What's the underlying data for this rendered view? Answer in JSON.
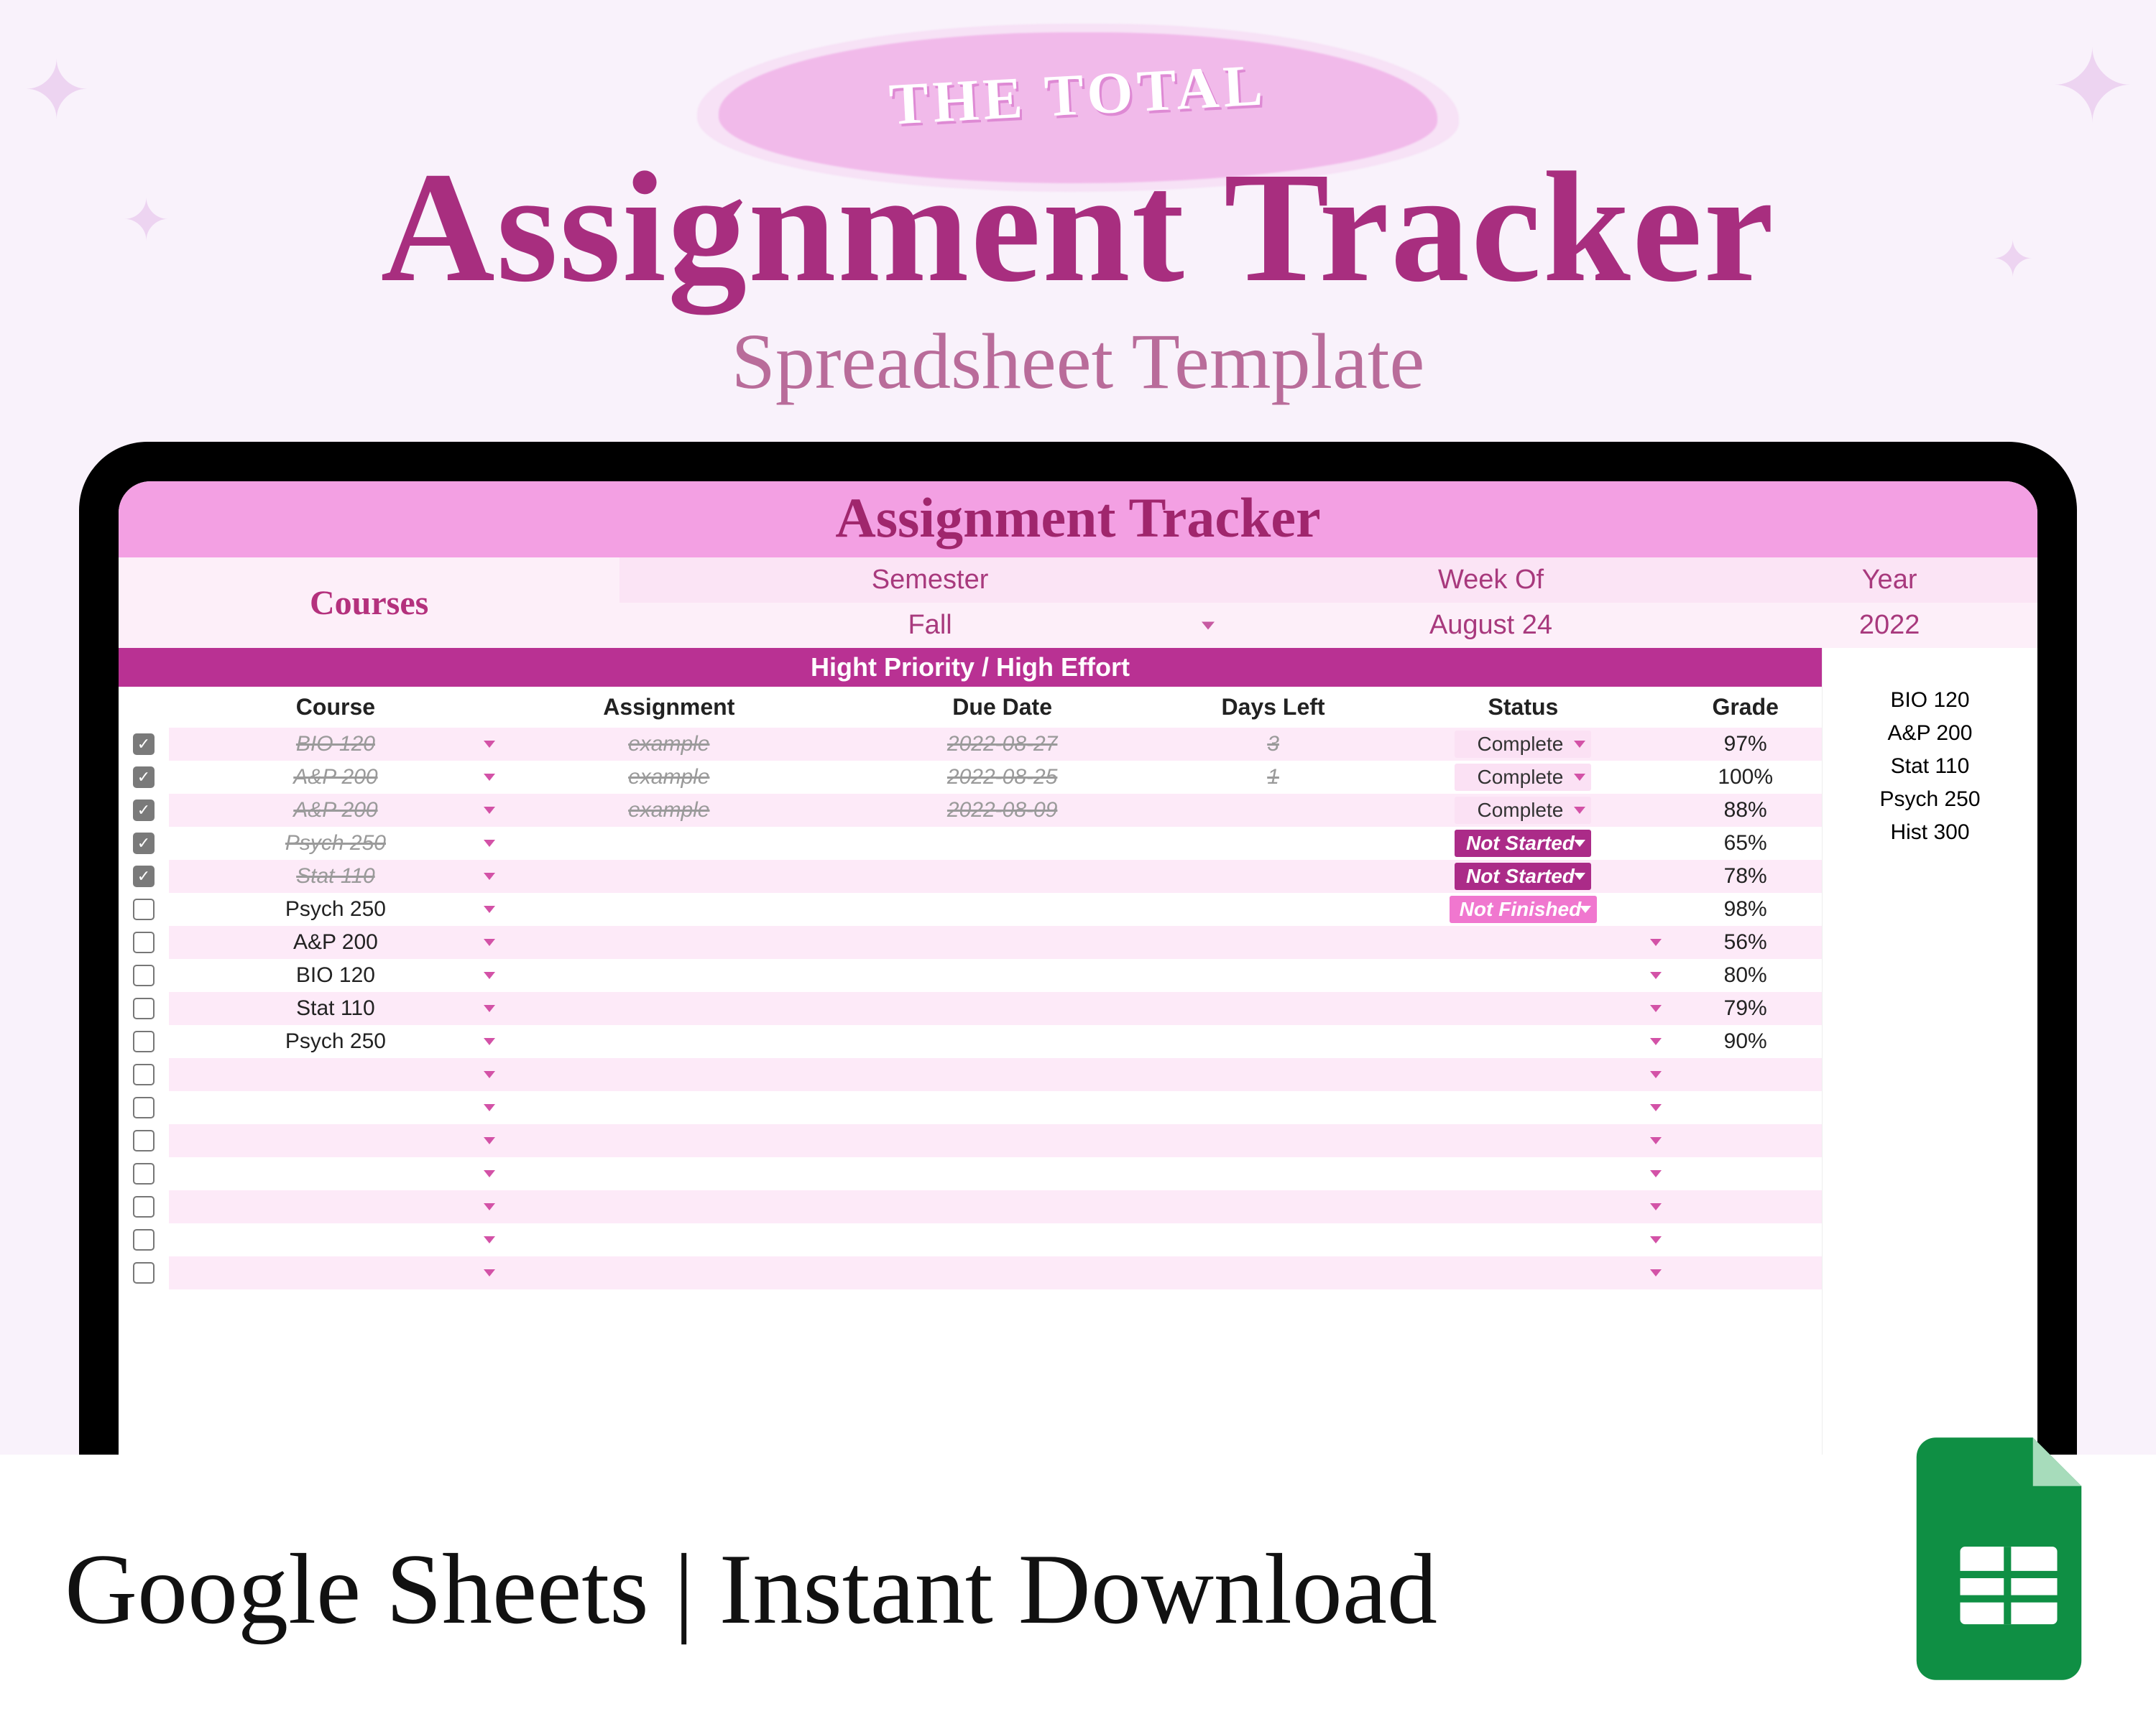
{
  "hero": {
    "pretitle": "THE TOTAL",
    "title": "Assignment Tracker",
    "subtitle": "Spreadsheet Template"
  },
  "spreadsheet": {
    "title": "Assignment Tracker",
    "meta": {
      "semester_label": "Semester",
      "week_label": "Week Of",
      "year_label": "Year",
      "courses_label": "Courses",
      "semester_value": "Fall",
      "week_value": "August 24",
      "year_value": "2022"
    },
    "section_banner": "Hight Priority / High Effort",
    "columns": {
      "course": "Course",
      "assignment": "Assignment",
      "due": "Due Date",
      "days_left": "Days Left",
      "status": "Status",
      "grade": "Grade"
    },
    "status_labels": {
      "complete": "Complete",
      "not_started": "Not Started",
      "not_finished": "Not Finished"
    },
    "rows": [
      {
        "checked": true,
        "course": "BIO 120",
        "assignment": "example",
        "due": "2022-08-27",
        "days_left": "3",
        "status": "complete",
        "grade": "97%"
      },
      {
        "checked": true,
        "course": "A&P 200",
        "assignment": "example",
        "due": "2022-08-25",
        "days_left": "1",
        "status": "complete",
        "grade": "100%"
      },
      {
        "checked": true,
        "course": "A&P 200",
        "assignment": "example",
        "due": "2022-08-09",
        "days_left": "",
        "status": "complete",
        "grade": "88%"
      },
      {
        "checked": true,
        "course": "Psych 250",
        "assignment": "",
        "due": "",
        "days_left": "",
        "status": "not_started",
        "grade": "65%"
      },
      {
        "checked": true,
        "course": "Stat 110",
        "assignment": "",
        "due": "",
        "days_left": "",
        "status": "not_started",
        "grade": "78%"
      },
      {
        "checked": false,
        "course": "Psych 250",
        "assignment": "",
        "due": "",
        "days_left": "",
        "status": "not_finished",
        "grade": "98%"
      },
      {
        "checked": false,
        "course": "A&P 200",
        "assignment": "",
        "due": "",
        "days_left": "",
        "status": "",
        "grade": "56%"
      },
      {
        "checked": false,
        "course": "BIO 120",
        "assignment": "",
        "due": "",
        "days_left": "",
        "status": "",
        "grade": "80%"
      },
      {
        "checked": false,
        "course": "Stat 110",
        "assignment": "",
        "due": "",
        "days_left": "",
        "status": "",
        "grade": "79%"
      },
      {
        "checked": false,
        "course": "Psych 250",
        "assignment": "",
        "due": "",
        "days_left": "",
        "status": "",
        "grade": "90%"
      },
      {
        "checked": false,
        "course": "",
        "assignment": "",
        "due": "",
        "days_left": "",
        "status": "",
        "grade": ""
      },
      {
        "checked": false,
        "course": "",
        "assignment": "",
        "due": "",
        "days_left": "",
        "status": "",
        "grade": ""
      },
      {
        "checked": false,
        "course": "",
        "assignment": "",
        "due": "",
        "days_left": "",
        "status": "",
        "grade": ""
      },
      {
        "checked": false,
        "course": "",
        "assignment": "",
        "due": "",
        "days_left": "",
        "status": "",
        "grade": ""
      },
      {
        "checked": false,
        "course": "",
        "assignment": "",
        "due": "",
        "days_left": "",
        "status": "",
        "grade": ""
      },
      {
        "checked": false,
        "course": "",
        "assignment": "",
        "due": "",
        "days_left": "",
        "status": "",
        "grade": ""
      },
      {
        "checked": false,
        "course": "",
        "assignment": "",
        "due": "",
        "days_left": "",
        "status": "",
        "grade": ""
      }
    ],
    "courses_list": [
      "BIO 120",
      "A&P 200",
      "Stat 110",
      "Psych 250",
      "Hist 300"
    ]
  },
  "footer": {
    "text": "Google Sheets | Instant Download"
  }
}
